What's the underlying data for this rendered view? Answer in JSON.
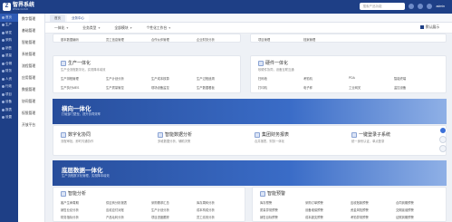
{
  "app": {
    "logo_text": "智界系统",
    "logo_sub": "ZHIJIE CLOUD",
    "search_placeholder": "搜索产品功能",
    "user": "admin"
  },
  "sidebar": {
    "items": [
      "首页",
      "生产",
      "研发",
      "采购",
      "销售",
      "质量",
      "仓储",
      "财务",
      "人资",
      "行政",
      "项目",
      "设备",
      "报表",
      "设置"
    ]
  },
  "subnav": {
    "items": [
      "数字管理",
      "基础管理",
      "智能管理",
      "系统管理",
      "流程管理",
      "应用管理",
      "数据管理",
      "协同管理",
      "权限管理",
      "开放平台"
    ]
  },
  "tabs": [
    {
      "label": "首页",
      "active": false
    },
    {
      "label": "业务中心",
      "active": true
    }
  ],
  "filters": [
    {
      "label": "一体化"
    },
    {
      "label": "业务类型"
    },
    {
      "label": "全部模块"
    },
    {
      "label": "个性化工作台"
    }
  ],
  "filter_right": "默认展示",
  "top_card_left": {
    "rows": [
      [
        "基本数据编码",
        "员工信息管理",
        "合作伙伴管理",
        "企业财务分析"
      ]
    ]
  },
  "top_card_right": {
    "rows": [
      [
        "项目管理",
        "档案管理"
      ]
    ]
  },
  "card_prod": {
    "title": "生产一体化",
    "desc": "生产全流程数字化，实现降本增效",
    "rows": [
      [
        "生产排程管理",
        "生产计划分析",
        "生产成本核算",
        "生产过程追溯"
      ],
      [
        "生产执行MES",
        "生产质量管控",
        "现场设备监控",
        "生产数据看板"
      ]
    ]
  },
  "card_proc": {
    "title": "硬件一体化",
    "desc": "软硬件协同，设备互联互通",
    "rows": [
      [
        "扫码枪",
        "考勤机",
        "PDA",
        "智能终端"
      ],
      [
        "打印机",
        "电子秤",
        "工业网关",
        "监控设备"
      ]
    ]
  },
  "section1": {
    "title": "横向一体化",
    "subtitle": "打破部门壁垒，提升协同效率"
  },
  "cards1": [
    {
      "title": "数字化协同",
      "desc": "流程审批，即时沟通协作"
    },
    {
      "title": "智能数据分析",
      "desc": "多维数据分析，辅助决策"
    },
    {
      "title": "集团财务报表",
      "desc": "合并报表，财务一体化"
    },
    {
      "title": "一键登录子系统",
      "desc": "统一身份认证，单点登录"
    }
  ],
  "section2": {
    "title": "底层数据一体化",
    "subtitle": "生产流程数字化管理，实现降本增效"
  },
  "cards2": [
    {
      "title": "智能分析",
      "rows": [
        [
          "客户生命周期",
          "供应商分析报表",
          "采购需求汇总",
          "库存周转分析"
        ],
        [
          "销售业绩分析",
          "应收应付对账",
          "生产计划分析",
          "成本构成分析"
        ],
        [
          "财务指标分析",
          "产品毛利分析",
          "项目进度跟踪",
          "员工绩效分析"
        ]
      ]
    },
    {
      "title": "智能预警",
      "rows": [
        [
          "库存预警",
          "采购订单预警",
          "应收账款预警",
          "合同到期预警"
        ],
        [
          "质量异常预警",
          "设备维保预警",
          "资金风险预警",
          "交期延误预警"
        ],
        [
          "销售目标预警",
          "成本超支预警",
          "考勤异常预警",
          "证照到期预警"
        ]
      ]
    }
  ]
}
